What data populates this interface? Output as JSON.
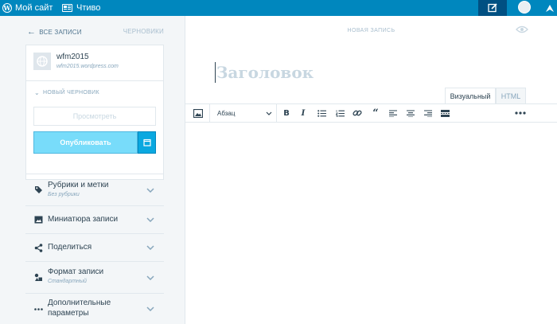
{
  "topbar": {
    "site_label": "Мой сайт",
    "reader_label": "Чтиво"
  },
  "sidebar": {
    "back_label": "ВСЕ ЗАПИСИ",
    "drafts_label": "ЧЕРНОВИКИ",
    "site": {
      "name": "wfm2015",
      "url": "wfm2015.wordpress.com"
    },
    "new_draft_label": "НОВЫЙ ЧЕРНОВИК",
    "preview_label": "Просмотреть",
    "publish_label": "Опубликовать",
    "sections": [
      {
        "title": "Рубрики и метки",
        "subtitle": "Без рубрики",
        "icon": "tag-icon"
      },
      {
        "title": "Миниатюра записи",
        "subtitle": "",
        "icon": "image-icon"
      },
      {
        "title": "Поделиться",
        "subtitle": "",
        "icon": "share-icon"
      },
      {
        "title": "Формат записи",
        "subtitle": "Стандартный",
        "icon": "post-format-icon"
      },
      {
        "title": "Дополнительные",
        "title2": "параметры",
        "subtitle": "",
        "icon": "more-icon"
      }
    ]
  },
  "editor": {
    "header_label": "НОВАЯ ЗАПИСЬ",
    "title_placeholder": "Заголовок",
    "tabs": [
      "Визуальный",
      "HTML"
    ],
    "active_tab": "Визуальный",
    "format_select": "Абзац"
  },
  "colors": {
    "topbar": "#0087be",
    "publish": "#78dcfa",
    "text": "#2e4453"
  }
}
